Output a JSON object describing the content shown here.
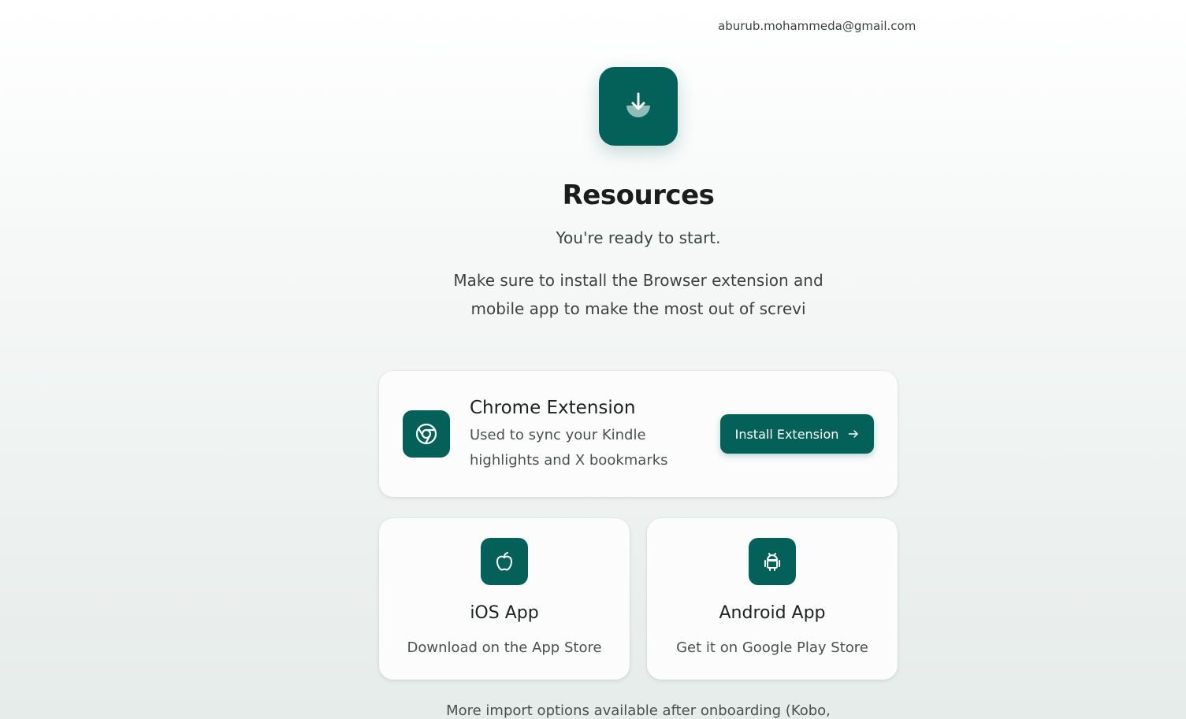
{
  "header": {
    "email": "aburub.mohammeda@gmail.com"
  },
  "hero": {
    "icon": "download-icon",
    "title": "Resources",
    "subtitle": "You're ready to start.",
    "description": "Make sure to install the Browser extension and mobile app to make the most out of screvi"
  },
  "chrome": {
    "icon": "chrome-icon",
    "title": "Chrome Extension",
    "description": "Used to sync your Kindle highlights and X bookmarks",
    "button_label": "Install Extension",
    "button_icon": "arrow-right-icon"
  },
  "ios": {
    "icon": "apple-icon",
    "title": "iOS App",
    "description": "Download on the App Store"
  },
  "android": {
    "icon": "android-icon",
    "title": "Android App",
    "description": "Get it on Google Play Store"
  },
  "footer": {
    "note": "More import options available after onboarding (Kobo,"
  },
  "colors": {
    "accent": "#036159",
    "accent_light": "#8fbdb8"
  }
}
